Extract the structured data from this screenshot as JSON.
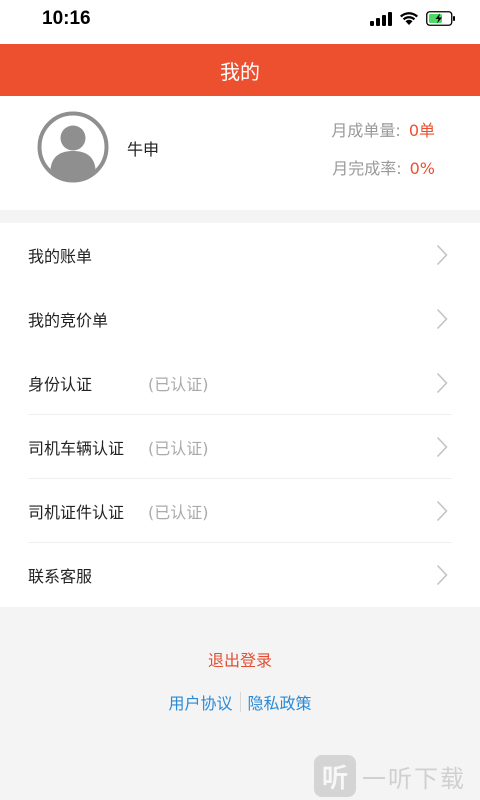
{
  "status_bar": {
    "time": "10:16"
  },
  "header": {
    "title": "我的"
  },
  "profile": {
    "name": "牛申",
    "monthly_orders_label": "月成单量:",
    "monthly_orders_value": "0单",
    "monthly_completion_label": "月完成率:",
    "monthly_completion_value": "0%"
  },
  "menu": {
    "items": [
      {
        "label": "我的账单",
        "status": ""
      },
      {
        "label": "我的竞价单",
        "status": ""
      },
      {
        "label": "身份认证",
        "status": "(已认证)"
      },
      {
        "label": "司机车辆认证",
        "status": "(已认证)"
      },
      {
        "label": "司机证件认证",
        "status": "(已认证)"
      },
      {
        "label": "联系客服",
        "status": ""
      }
    ]
  },
  "footer": {
    "logout": "退出登录",
    "user_agreement": "用户协议",
    "privacy_policy": "隐私政策"
  },
  "watermark": {
    "logo_char": "听",
    "text": "一听下载"
  },
  "colors": {
    "brand": "#ec502f",
    "link": "#2a8ad6",
    "muted": "#999999"
  }
}
